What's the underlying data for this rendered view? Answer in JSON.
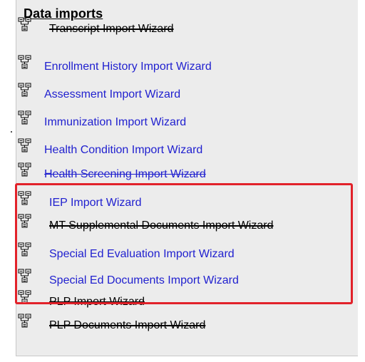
{
  "section": {
    "title": "Data imports"
  },
  "items": [
    {
      "label": "Transcript Import Wizard",
      "struck": true,
      "icon": "wizard-tree-icon"
    },
    {
      "label": "Enrollment History Import Wizard",
      "struck": false,
      "icon": "wizard-tree-icon"
    },
    {
      "label": "Assessment Import Wizard",
      "struck": false,
      "icon": "wizard-tree-icon"
    },
    {
      "label": "Immunization Import Wizard",
      "struck": false,
      "icon": "wizard-tree-icon"
    },
    {
      "label": "Health Condition Import Wizard",
      "struck": false,
      "icon": "wizard-tree-icon"
    },
    {
      "label": "Health Screening Import Wizard",
      "struck": false,
      "icon": "wizard-tree-icon"
    },
    {
      "label": "IEP Import Wizard",
      "struck": false,
      "icon": "wizard-tree-icon"
    },
    {
      "label": "MT Supplemental Documents Import Wizard",
      "struck": true,
      "icon": "wizard-tree-icon"
    },
    {
      "label": "Special Ed Evaluation Import Wizard",
      "struck": false,
      "icon": "wizard-tree-icon"
    },
    {
      "label": "Special Ed Documents Import Wizard",
      "struck": false,
      "icon": "wizard-tree-icon"
    },
    {
      "label": "PLP Import Wizard",
      "struck": true,
      "icon": "wizard-tree-icon"
    },
    {
      "label": "PLP Documents Import Wizard",
      "struck": true,
      "icon": "wizard-tree-icon"
    }
  ],
  "colors": {
    "link": "#1f1fcf",
    "highlight": "#e2222a",
    "panel": "#ececec"
  }
}
